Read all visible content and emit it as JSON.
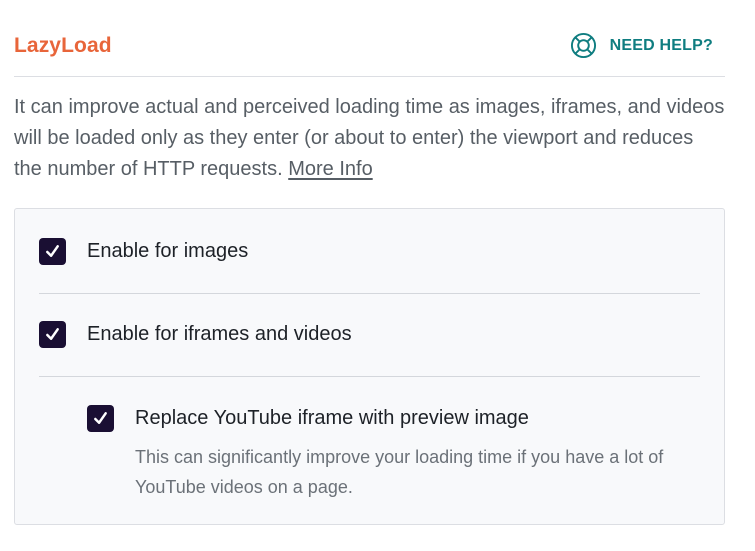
{
  "header": {
    "title": "LazyLoad",
    "help_label": "NEED HELP?",
    "help_icon": "lifebuoy-icon"
  },
  "description": {
    "text": "It can improve actual and perceived loading time as images, iframes, and videos will be loaded only as they enter (or about to enter) the viewport and reduces the number of HTTP requests.",
    "link_label": "More Info"
  },
  "options": [
    {
      "label": "Enable for images",
      "checked": true
    },
    {
      "label": "Enable for iframes and videos",
      "checked": true
    },
    {
      "label": "Replace YouTube iframe with preview image",
      "checked": true,
      "help": "This can significantly improve your loading time if you have a lot of YouTube videos on a page."
    }
  ],
  "colors": {
    "title": "#e8653a",
    "help": "#0f7d80",
    "checkbox": "#1a0f33"
  }
}
